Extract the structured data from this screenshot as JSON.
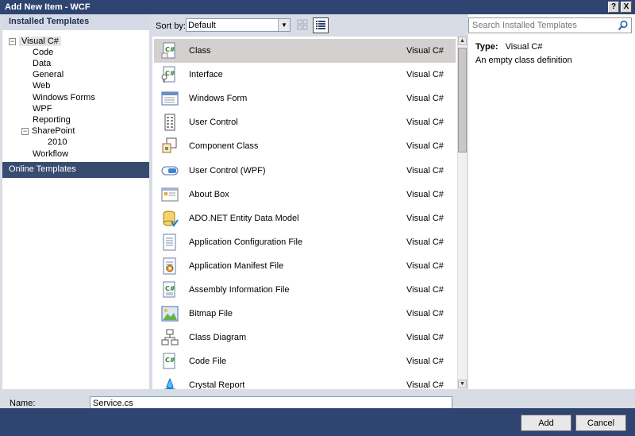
{
  "window": {
    "title": "Add New Item - WCF",
    "help_label": "?",
    "close_label": "X"
  },
  "left": {
    "header": "Installed Templates",
    "tree": [
      {
        "label": "Visual C#",
        "expander": "−",
        "selected": true
      },
      {
        "label": "Code"
      },
      {
        "label": "Data"
      },
      {
        "label": "General"
      },
      {
        "label": "Web"
      },
      {
        "label": "Windows Forms"
      },
      {
        "label": "WPF"
      },
      {
        "label": "Reporting"
      },
      {
        "label": "SharePoint",
        "expander": "−"
      },
      {
        "label": "2010"
      },
      {
        "label": "Workflow"
      }
    ],
    "online": "Online Templates"
  },
  "toolbar": {
    "sort_label": "Sort by:",
    "sort_value": "Default"
  },
  "search": {
    "placeholder": "Search Installed Templates"
  },
  "templates": [
    {
      "name": "Class",
      "lang": "Visual C#",
      "icon": "class-icon",
      "selected": true
    },
    {
      "name": "Interface",
      "lang": "Visual C#",
      "icon": "interface-icon"
    },
    {
      "name": "Windows Form",
      "lang": "Visual C#",
      "icon": "windows-form-icon"
    },
    {
      "name": "User Control",
      "lang": "Visual C#",
      "icon": "user-control-icon"
    },
    {
      "name": "Component Class",
      "lang": "Visual C#",
      "icon": "component-class-icon"
    },
    {
      "name": "User Control (WPF)",
      "lang": "Visual C#",
      "icon": "wpf-user-control-icon"
    },
    {
      "name": "About Box",
      "lang": "Visual C#",
      "icon": "about-box-icon"
    },
    {
      "name": "ADO.NET Entity Data Model",
      "lang": "Visual C#",
      "icon": "entity-data-model-icon"
    },
    {
      "name": "Application Configuration File",
      "lang": "Visual C#",
      "icon": "config-file-icon"
    },
    {
      "name": "Application Manifest File",
      "lang": "Visual C#",
      "icon": "manifest-file-icon"
    },
    {
      "name": "Assembly Information File",
      "lang": "Visual C#",
      "icon": "assembly-info-icon"
    },
    {
      "name": "Bitmap File",
      "lang": "Visual C#",
      "icon": "bitmap-file-icon"
    },
    {
      "name": "Class Diagram",
      "lang": "Visual C#",
      "icon": "class-diagram-icon"
    },
    {
      "name": "Code File",
      "lang": "Visual C#",
      "icon": "code-file-icon"
    },
    {
      "name": "Crystal Report",
      "lang": "Visual C#",
      "icon": "crystal-report-icon"
    }
  ],
  "details": {
    "type_label": "Type:",
    "type_value": "Visual C#",
    "description": "An empty class definition"
  },
  "bottom": {
    "name_label": "Name:",
    "name_value": "Service.cs",
    "add_label": "Add",
    "cancel_label": "Cancel"
  },
  "colors": {
    "titlebar": "#2f4470",
    "online_selected": "#384c70",
    "selected_row": "#d4d0d0"
  }
}
